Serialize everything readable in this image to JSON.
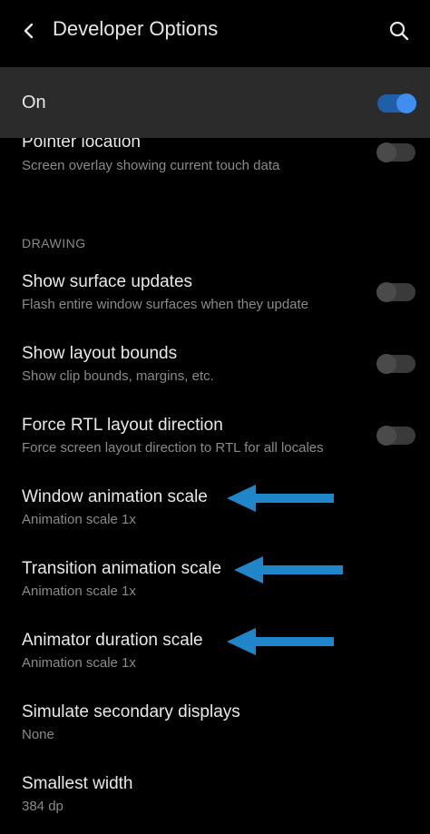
{
  "header": {
    "title": "Developer Options",
    "back_icon": "chevron-left-icon",
    "search_icon": "search-icon"
  },
  "master_switch": {
    "label": "On",
    "enabled": true
  },
  "items": [
    {
      "title": "Pointer location",
      "subtitle": "Screen overlay showing current touch data",
      "has_toggle": true,
      "on": false
    },
    {
      "title": "Show surface updates",
      "subtitle": "Flash entire window surfaces when they update",
      "has_toggle": true,
      "on": false
    },
    {
      "title": "Show layout bounds",
      "subtitle": "Show clip bounds, margins, etc.",
      "has_toggle": true,
      "on": false
    },
    {
      "title": "Force RTL layout direction",
      "subtitle": "Force screen layout direction to RTL for all locales",
      "has_toggle": true,
      "on": false
    },
    {
      "title": "Window animation scale",
      "subtitle": "Animation scale 1x",
      "has_toggle": false
    },
    {
      "title": "Transition animation scale",
      "subtitle": "Animation scale 1x",
      "has_toggle": false
    },
    {
      "title": "Animator duration scale",
      "subtitle": "Animation scale 1x",
      "has_toggle": false
    },
    {
      "title": "Simulate secondary displays",
      "subtitle": "None",
      "has_toggle": false
    },
    {
      "title": "Smallest width",
      "subtitle": "384 dp",
      "has_toggle": false
    }
  ],
  "section": {
    "drawing": "DRAWING"
  },
  "colors": {
    "background": "#000000",
    "master_row_bg": "#2b2b2b",
    "accent": "#3f8ef0",
    "annotation_arrow": "#1f87c9"
  }
}
